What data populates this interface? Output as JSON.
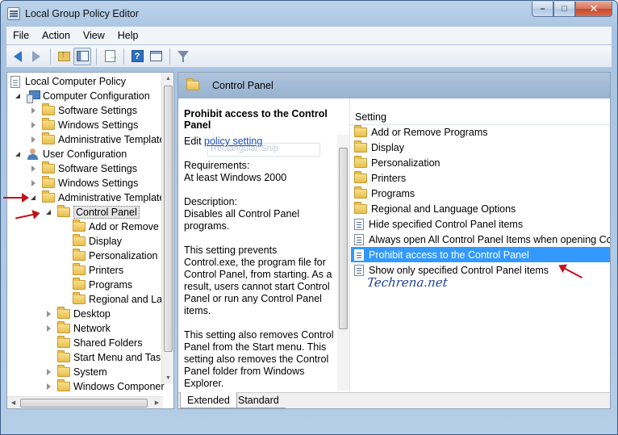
{
  "window": {
    "title": "Local Group Policy Editor",
    "minimize": "–",
    "maximize": "□",
    "close": "✕"
  },
  "menu": [
    "File",
    "Action",
    "View",
    "Help"
  ],
  "toolbar": {
    "help_glyph": "?"
  },
  "tree": {
    "root": "Local Computer Policy",
    "computer_configuration": "Computer Configuration",
    "cc_software": "Software Settings",
    "cc_windows": "Windows Settings",
    "cc_admin": "Administrative Template",
    "user_configuration": "User Configuration",
    "uc_software": "Software Settings",
    "uc_windows": "Windows Settings",
    "uc_admin": "Administrative Template",
    "control_panel": "Control Panel",
    "cp_children": [
      "Add or Remove P",
      "Display",
      "Personalization",
      "Printers",
      "Programs",
      "Regional and Lan"
    ],
    "uc_admin_children": [
      "Desktop",
      "Network",
      "Shared Folders",
      "Start Menu and Taskl",
      "System",
      "Windows Componer"
    ]
  },
  "details": {
    "header": "Control Panel",
    "policy_title": "Prohibit access to the Control Panel",
    "edit_prefix": "Edit ",
    "edit_link": "policy setting",
    "ghost_text": "Rectangular Snip",
    "requirements_label": "Requirements:",
    "requirements_value": "At least Windows 2000",
    "description_label": "Description:",
    "description_value": "Disables all Control Panel programs.",
    "para1": "This setting prevents Control.exe, the program file for Control Panel, from starting. As a result, users cannot start Control Panel or run any Control Panel items.",
    "para2": "This setting also removes Control Panel from the Start menu. This setting also removes the Control Panel folder from Windows Explorer."
  },
  "settings": {
    "column_header": "Setting",
    "folders": [
      "Add or Remove Programs",
      "Display",
      "Personalization",
      "Printers",
      "Programs",
      "Regional and Language Options"
    ],
    "policies": [
      "Hide specified Control Panel items",
      "Always open All Control Panel Items when opening Control",
      "Prohibit access to the Control Panel",
      "Show only specified Control Panel items"
    ]
  },
  "watermark": "Techrena.net",
  "tabs": [
    "Extended",
    "Standard"
  ],
  "colors": {
    "selection": "#3399ff",
    "annotation_arrow": "#c0141a",
    "header_band": "#98b2d1"
  }
}
